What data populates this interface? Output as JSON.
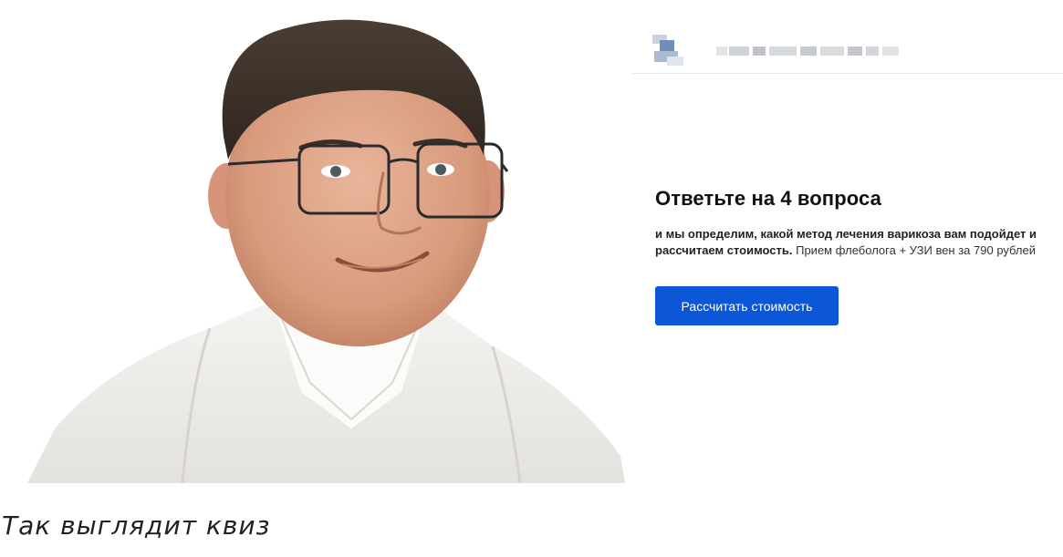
{
  "photo": {
    "alt_icon": "doctor-portrait"
  },
  "header": {
    "logo_icon": "blurred-logo-icon",
    "title": ""
  },
  "quiz": {
    "heading": "Ответьте на 4 вопроса",
    "desc_bold": "и мы определим, какой метод лечения варикоза вам подойдет и рассчитаем стоимость.",
    "desc_regular": " Прием флеболога + УЗИ вен за 790 рублей",
    "button_label": "Рассчитать стоимость"
  },
  "caption": "Так выглядит квиз",
  "colors": {
    "accent": "#0b57d8",
    "text": "#111111",
    "divider": "#e6e8eb"
  }
}
